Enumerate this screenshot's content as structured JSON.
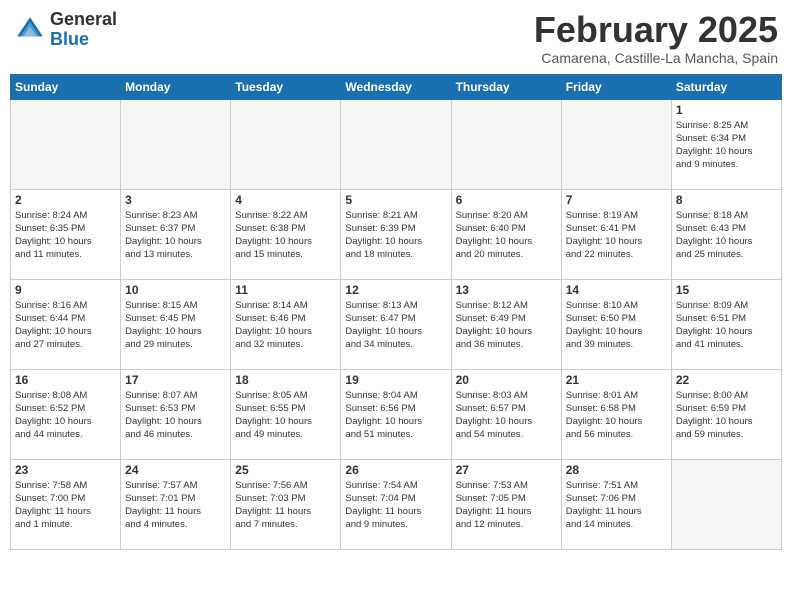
{
  "header": {
    "logo_general": "General",
    "logo_blue": "Blue",
    "month_title": "February 2025",
    "location": "Camarena, Castille-La Mancha, Spain"
  },
  "weekdays": [
    "Sunday",
    "Monday",
    "Tuesday",
    "Wednesday",
    "Thursday",
    "Friday",
    "Saturday"
  ],
  "weeks": [
    [
      {
        "day": "",
        "info": ""
      },
      {
        "day": "",
        "info": ""
      },
      {
        "day": "",
        "info": ""
      },
      {
        "day": "",
        "info": ""
      },
      {
        "day": "",
        "info": ""
      },
      {
        "day": "",
        "info": ""
      },
      {
        "day": "1",
        "info": "Sunrise: 8:25 AM\nSunset: 6:34 PM\nDaylight: 10 hours\nand 9 minutes."
      }
    ],
    [
      {
        "day": "2",
        "info": "Sunrise: 8:24 AM\nSunset: 6:35 PM\nDaylight: 10 hours\nand 11 minutes."
      },
      {
        "day": "3",
        "info": "Sunrise: 8:23 AM\nSunset: 6:37 PM\nDaylight: 10 hours\nand 13 minutes."
      },
      {
        "day": "4",
        "info": "Sunrise: 8:22 AM\nSunset: 6:38 PM\nDaylight: 10 hours\nand 15 minutes."
      },
      {
        "day": "5",
        "info": "Sunrise: 8:21 AM\nSunset: 6:39 PM\nDaylight: 10 hours\nand 18 minutes."
      },
      {
        "day": "6",
        "info": "Sunrise: 8:20 AM\nSunset: 6:40 PM\nDaylight: 10 hours\nand 20 minutes."
      },
      {
        "day": "7",
        "info": "Sunrise: 8:19 AM\nSunset: 6:41 PM\nDaylight: 10 hours\nand 22 minutes."
      },
      {
        "day": "8",
        "info": "Sunrise: 8:18 AM\nSunset: 6:43 PM\nDaylight: 10 hours\nand 25 minutes."
      }
    ],
    [
      {
        "day": "9",
        "info": "Sunrise: 8:16 AM\nSunset: 6:44 PM\nDaylight: 10 hours\nand 27 minutes."
      },
      {
        "day": "10",
        "info": "Sunrise: 8:15 AM\nSunset: 6:45 PM\nDaylight: 10 hours\nand 29 minutes."
      },
      {
        "day": "11",
        "info": "Sunrise: 8:14 AM\nSunset: 6:46 PM\nDaylight: 10 hours\nand 32 minutes."
      },
      {
        "day": "12",
        "info": "Sunrise: 8:13 AM\nSunset: 6:47 PM\nDaylight: 10 hours\nand 34 minutes."
      },
      {
        "day": "13",
        "info": "Sunrise: 8:12 AM\nSunset: 6:49 PM\nDaylight: 10 hours\nand 36 minutes."
      },
      {
        "day": "14",
        "info": "Sunrise: 8:10 AM\nSunset: 6:50 PM\nDaylight: 10 hours\nand 39 minutes."
      },
      {
        "day": "15",
        "info": "Sunrise: 8:09 AM\nSunset: 6:51 PM\nDaylight: 10 hours\nand 41 minutes."
      }
    ],
    [
      {
        "day": "16",
        "info": "Sunrise: 8:08 AM\nSunset: 6:52 PM\nDaylight: 10 hours\nand 44 minutes."
      },
      {
        "day": "17",
        "info": "Sunrise: 8:07 AM\nSunset: 6:53 PM\nDaylight: 10 hours\nand 46 minutes."
      },
      {
        "day": "18",
        "info": "Sunrise: 8:05 AM\nSunset: 6:55 PM\nDaylight: 10 hours\nand 49 minutes."
      },
      {
        "day": "19",
        "info": "Sunrise: 8:04 AM\nSunset: 6:56 PM\nDaylight: 10 hours\nand 51 minutes."
      },
      {
        "day": "20",
        "info": "Sunrise: 8:03 AM\nSunset: 6:57 PM\nDaylight: 10 hours\nand 54 minutes."
      },
      {
        "day": "21",
        "info": "Sunrise: 8:01 AM\nSunset: 6:58 PM\nDaylight: 10 hours\nand 56 minutes."
      },
      {
        "day": "22",
        "info": "Sunrise: 8:00 AM\nSunset: 6:59 PM\nDaylight: 10 hours\nand 59 minutes."
      }
    ],
    [
      {
        "day": "23",
        "info": "Sunrise: 7:58 AM\nSunset: 7:00 PM\nDaylight: 11 hours\nand 1 minute."
      },
      {
        "day": "24",
        "info": "Sunrise: 7:57 AM\nSunset: 7:01 PM\nDaylight: 11 hours\nand 4 minutes."
      },
      {
        "day": "25",
        "info": "Sunrise: 7:56 AM\nSunset: 7:03 PM\nDaylight: 11 hours\nand 7 minutes."
      },
      {
        "day": "26",
        "info": "Sunrise: 7:54 AM\nSunset: 7:04 PM\nDaylight: 11 hours\nand 9 minutes."
      },
      {
        "day": "27",
        "info": "Sunrise: 7:53 AM\nSunset: 7:05 PM\nDaylight: 11 hours\nand 12 minutes."
      },
      {
        "day": "28",
        "info": "Sunrise: 7:51 AM\nSunset: 7:06 PM\nDaylight: 11 hours\nand 14 minutes."
      },
      {
        "day": "",
        "info": ""
      }
    ]
  ]
}
